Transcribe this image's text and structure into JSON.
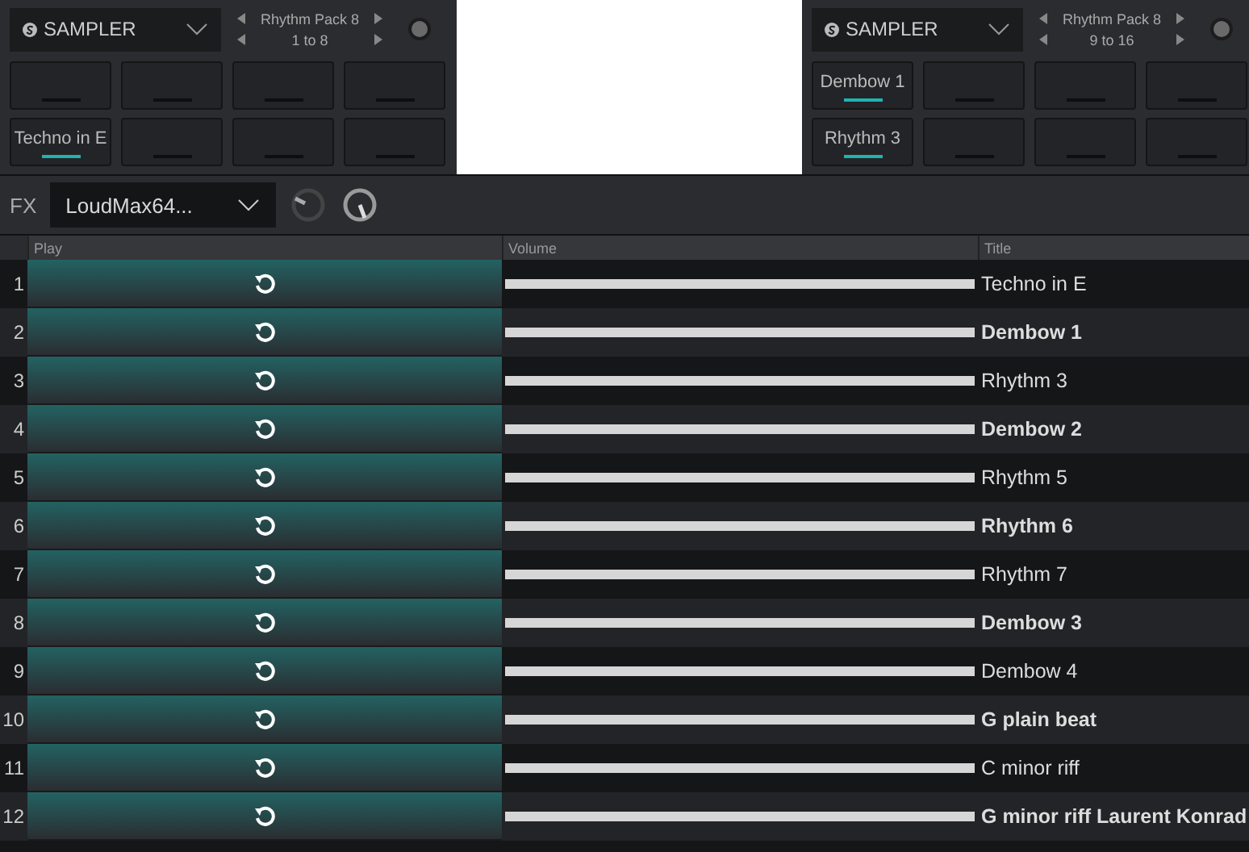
{
  "decks": [
    {
      "mode": "SAMPLER",
      "pack": "Rhythm Pack 8",
      "range": "1 to 8",
      "pads": [
        {
          "loaded": false
        },
        {
          "loaded": false
        },
        {
          "loaded": false
        },
        {
          "loaded": false
        },
        {
          "loaded": true,
          "label": "Techno in E"
        },
        {
          "loaded": false
        },
        {
          "loaded": false
        },
        {
          "loaded": false
        }
      ]
    },
    {
      "mode": "SAMPLER",
      "pack": "Rhythm Pack 8",
      "range": "9 to 16",
      "pads": [
        {
          "loaded": true,
          "label": "Dembow 1"
        },
        {
          "loaded": false
        },
        {
          "loaded": false
        },
        {
          "loaded": false
        },
        {
          "loaded": true,
          "label": "Rhythm 3"
        },
        {
          "loaded": false
        },
        {
          "loaded": false
        },
        {
          "loaded": false
        }
      ]
    }
  ],
  "fx": {
    "label": "FX",
    "effect": "LoudMax64..."
  },
  "table": {
    "columns": [
      "Play",
      "Volume",
      "Title"
    ],
    "rows": [
      {
        "index": "1",
        "level": 1,
        "title": "Techno in E"
      },
      {
        "index": "2",
        "level": 1,
        "title": "Dembow 1"
      },
      {
        "index": "3",
        "level": 1,
        "title": "Rhythm 3"
      },
      {
        "index": "4",
        "level": 1,
        "title": "Dembow 2"
      },
      {
        "index": "5",
        "level": 1,
        "title": "Rhythm 5"
      },
      {
        "index": "6",
        "level": 1,
        "title": "Rhythm 6"
      },
      {
        "index": "7",
        "level": 1,
        "title": "Rhythm 7"
      },
      {
        "index": "8",
        "level": 1,
        "title": "Dembow 3"
      },
      {
        "index": "9",
        "level": 1,
        "title": "Dembow 4"
      },
      {
        "index": "10",
        "level": 1,
        "title": "G plain beat"
      },
      {
        "index": "11",
        "level": 1,
        "title": "C minor riff"
      },
      {
        "index": "12",
        "level": 1,
        "title": "G minor riff Laurent Konrad"
      }
    ]
  }
}
